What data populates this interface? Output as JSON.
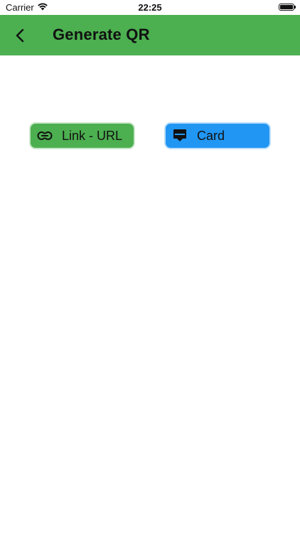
{
  "status_bar": {
    "carrier": "Carrier",
    "time": "22:25",
    "battery_level": 1.0
  },
  "app_bar": {
    "title": "Generate QR",
    "background_color": "#4caf50",
    "back_icon": "chevron-left-icon"
  },
  "buttons": [
    {
      "label": "Link - URL",
      "icon": "link-icon",
      "color": "#4caf50"
    },
    {
      "label": "Card",
      "icon": "card-icon",
      "color": "#2196f3"
    }
  ]
}
